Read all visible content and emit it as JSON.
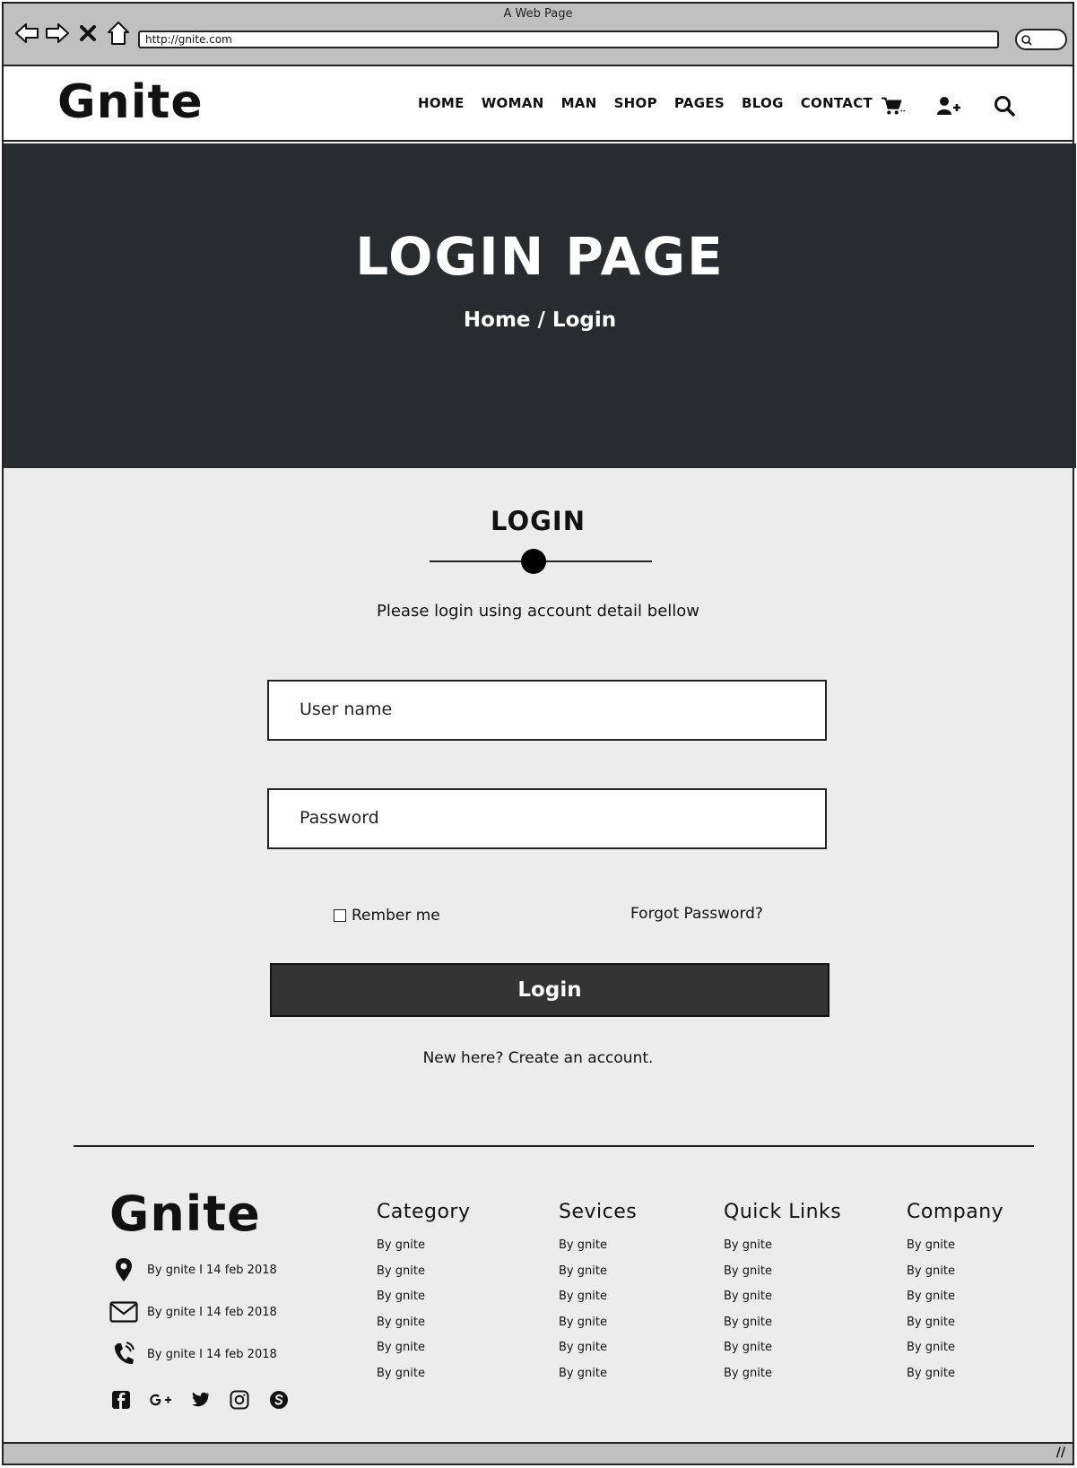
{
  "browser": {
    "window_title": "A Web Page",
    "url": "http://gnite.com"
  },
  "header": {
    "logo": "Gnite",
    "nav": [
      "HOME",
      "WOMAN",
      "MAN",
      "SHOP",
      "PAGES",
      "BLOG",
      "CONTACT"
    ],
    "icons": [
      "cart-icon",
      "add-user-icon",
      "search-icon"
    ]
  },
  "hero": {
    "title": "LOGIN PAGE",
    "breadcrumb_home": "Home",
    "breadcrumb_sep": "/",
    "breadcrumb_current": "Login"
  },
  "login": {
    "heading": "LOGIN",
    "subtitle": "Please login using account detail bellow",
    "username_placeholder": "User name",
    "password_placeholder": "Password",
    "remember_label": "Rember me",
    "forgot_label": "Forgot Password?",
    "submit_label": "Login",
    "signup_text": "New here? Create an account."
  },
  "footer": {
    "logo": "Gnite",
    "contacts": [
      {
        "icon": "location-pin-icon",
        "text": "By gnite I 14 feb 2018"
      },
      {
        "icon": "envelope-icon",
        "text": "By gnite I 14 feb 2018"
      },
      {
        "icon": "phone-icon",
        "text": "By gnite I 14 feb 2018"
      }
    ],
    "social": [
      "facebook-icon",
      "google-plus-icon",
      "twitter-icon",
      "instagram-icon",
      "skype-icon"
    ],
    "columns": [
      {
        "title": "Category",
        "items": [
          "By gnite",
          "By gnite",
          "By gnite",
          "By gnite",
          "By gnite",
          "By gnite"
        ]
      },
      {
        "title": "Sevices",
        "items": [
          "By gnite",
          "By gnite",
          "By gnite",
          "By gnite",
          "By gnite",
          "By gnite"
        ]
      },
      {
        "title": "Quick Links",
        "items": [
          "By gnite",
          "By gnite",
          "By gnite",
          "By gnite",
          "By gnite",
          "By gnite"
        ]
      },
      {
        "title": "Company",
        "items": [
          "By gnite",
          "By gnite",
          "By gnite",
          "By gnite",
          "By gnite",
          "By gnite"
        ]
      }
    ]
  }
}
